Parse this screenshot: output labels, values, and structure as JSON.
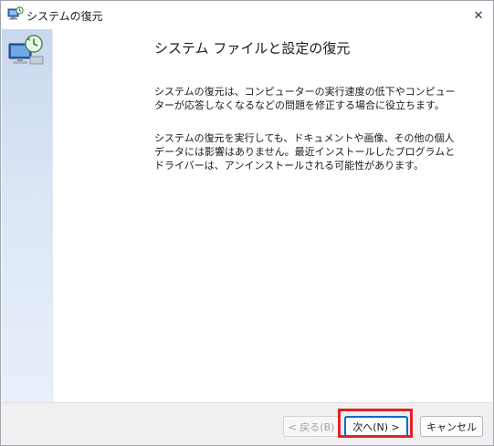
{
  "window": {
    "title": "システムの復元",
    "close_glyph": "✕"
  },
  "content": {
    "heading": "システム ファイルと設定の復元",
    "paragraph1": "システムの復元は、コンピューターの実行速度の低下やコンピューターが応答しなくなるなどの問題を修正する場合に役立ちます。",
    "paragraph2": "システムの復元を実行しても、ドキュメントや画像、その他の個人データには影響はありません。最近インストールしたプログラムとドライバーは、アンインストールされる可能性があります。"
  },
  "buttons": {
    "back_label": "< 戻る(B)",
    "next_label": "次へ(N) >",
    "cancel_label": "キャンセル"
  },
  "colors": {
    "accent": "#0b6cc4",
    "highlight": "#e3222a"
  },
  "icons": {
    "title": "system-restore-icon",
    "side": "system-restore-computer-icon"
  }
}
